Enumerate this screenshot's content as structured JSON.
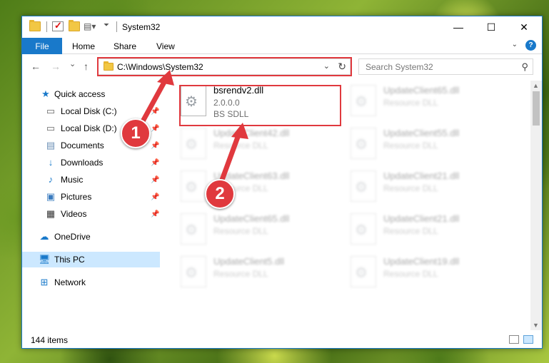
{
  "window": {
    "title": "System32",
    "minimize": "—",
    "maximize": "☐",
    "close": "✕"
  },
  "ribbon": {
    "file": "File",
    "tabs": [
      "Home",
      "Share",
      "View"
    ],
    "help": "?"
  },
  "nav": {
    "back": "←",
    "forward": "→",
    "recent": "⌄",
    "up": "↑",
    "address": "C:\\Windows\\System32",
    "search_placeholder": "Search System32"
  },
  "sidebar": {
    "items": [
      {
        "label": "Quick access",
        "icon": "star-icon",
        "pinned": false
      },
      {
        "label": "Local Disk (C:)",
        "icon": "drive-icon",
        "pinned": true
      },
      {
        "label": "Local Disk (D:)",
        "icon": "drive-icon",
        "pinned": true
      },
      {
        "label": "Documents",
        "icon": "document-icon",
        "pinned": true
      },
      {
        "label": "Downloads",
        "icon": "download-icon",
        "pinned": true
      },
      {
        "label": "Music",
        "icon": "music-icon",
        "pinned": true
      },
      {
        "label": "Pictures",
        "icon": "pictures-icon",
        "pinned": true
      },
      {
        "label": "Videos",
        "icon": "video-icon",
        "pinned": true
      },
      {
        "label": "OneDrive",
        "icon": "cloud-icon",
        "pinned": false
      },
      {
        "label": "This PC",
        "icon": "computer-icon",
        "pinned": false
      },
      {
        "label": "Network",
        "icon": "network-icon",
        "pinned": false
      }
    ],
    "selected": "This PC"
  },
  "files": [
    {
      "name": "bsrendv2.dll",
      "line2": "2.0.0.0",
      "line3": "BS SDLL"
    },
    {
      "name": "UpdateClient65.dll",
      "line2": "Resource DLL"
    },
    {
      "name": "UpdateClient42.dll",
      "line2": "Resource DLL"
    },
    {
      "name": "UpdateClient55.dll",
      "line2": "Resource DLL"
    },
    {
      "name": "UpdateClient63.dll",
      "line2": "Resource DLL"
    },
    {
      "name": "UpdateClient21.dll",
      "line2": "Resource DLL"
    },
    {
      "name": "UpdateClient65.dll",
      "line2": "Resource DLL"
    },
    {
      "name": "UpdateClient21.dll",
      "line2": "Resource DLL"
    },
    {
      "name": "UpdateClient5.dll",
      "line2": "Resource DLL"
    },
    {
      "name": "UpdateClient19.dll",
      "line2": "Resource DLL"
    }
  ],
  "status": {
    "count": "144 items"
  },
  "annotations": {
    "step1": "1",
    "step2": "2",
    "color": "#e0393e"
  }
}
